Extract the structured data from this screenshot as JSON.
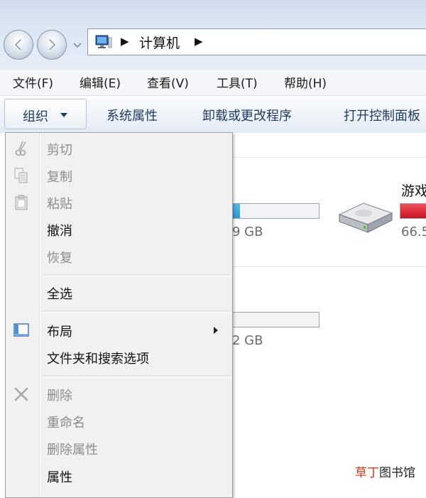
{
  "address_bar": {
    "location": "计算机"
  },
  "menu_bar": {
    "items": [
      {
        "label": "文件(F)"
      },
      {
        "label": "编辑(E)"
      },
      {
        "label": "查看(V)"
      },
      {
        "label": "工具(T)"
      },
      {
        "label": "帮助(H)"
      }
    ]
  },
  "command_bar": {
    "organize": "组织",
    "items": [
      {
        "label": "系统属性"
      },
      {
        "label": "卸载或更改程序"
      },
      {
        "label": "打开控制面板"
      }
    ]
  },
  "content": {
    "drives": [
      {
        "size_text": "9 GB",
        "fill_fraction": 0.13,
        "fill_color": "#2f9ad4"
      },
      {
        "size_text": "2 GB",
        "fill_fraction": 0.0,
        "fill_color": "#2f9ad4"
      },
      {
        "name": "游戏",
        "size_text": "66.5",
        "fill_color": "#d61f2a"
      }
    ]
  },
  "organize_menu": {
    "items": [
      {
        "label": "剪切",
        "enabled": false,
        "icon": "scissors-icon"
      },
      {
        "label": "复制",
        "enabled": false,
        "icon": "copy-icon"
      },
      {
        "label": "粘贴",
        "enabled": false,
        "icon": "paste-icon"
      },
      {
        "label": "撤消",
        "enabled": true
      },
      {
        "label": "恢复",
        "enabled": false
      },
      {
        "label": "全选",
        "enabled": true
      },
      {
        "label": "布局",
        "enabled": true,
        "icon": "layout-icon",
        "submenu": true
      },
      {
        "label": "文件夹和搜索选项",
        "enabled": true
      },
      {
        "label": "删除",
        "enabled": false,
        "icon": "delete-icon"
      },
      {
        "label": "重命名",
        "enabled": false
      },
      {
        "label": "删除属性",
        "enabled": false
      },
      {
        "label": "属性",
        "enabled": true
      }
    ]
  },
  "watermark": {
    "part1": "草丁",
    "part2": "图书馆"
  }
}
